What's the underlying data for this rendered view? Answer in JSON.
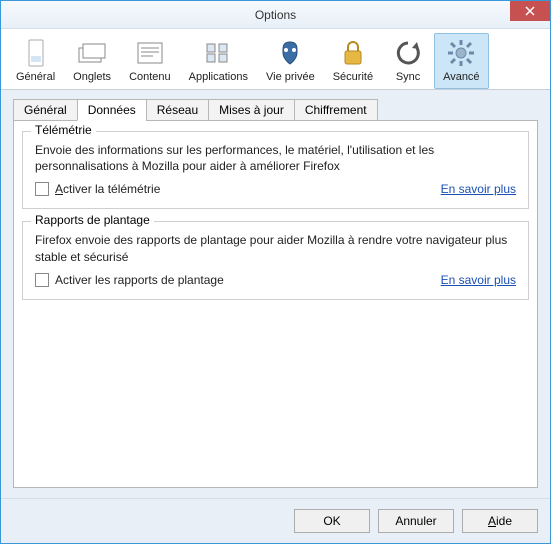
{
  "window": {
    "title": "Options"
  },
  "toolbar": [
    {
      "id": "general",
      "label": "Général"
    },
    {
      "id": "tabs",
      "label": "Onglets"
    },
    {
      "id": "content",
      "label": "Contenu"
    },
    {
      "id": "apps",
      "label": "Applications"
    },
    {
      "id": "privacy",
      "label": "Vie privée"
    },
    {
      "id": "security",
      "label": "Sécurité"
    },
    {
      "id": "sync",
      "label": "Sync"
    },
    {
      "id": "advanced",
      "label": "Avancé",
      "selected": true
    }
  ],
  "subtabs": [
    {
      "id": "gen",
      "label": "Général"
    },
    {
      "id": "data",
      "label": "Données",
      "active": true
    },
    {
      "id": "net",
      "label": "Réseau"
    },
    {
      "id": "upd",
      "label": "Mises à jour"
    },
    {
      "id": "enc",
      "label": "Chiffrement"
    }
  ],
  "groups": {
    "telemetry": {
      "title": "Télémétrie",
      "desc": "Envoie des informations sur les performances, le matériel, l'utilisation et les personnalisations à Mozilla pour aider à améliorer Firefox",
      "checkbox_pre": "A",
      "checkbox_post": "ctiver la télémétrie",
      "learn": "En savoir plus"
    },
    "crash": {
      "title": "Rapports de plantage",
      "desc": "Firefox envoie des rapports de plantage pour aider Mozilla à rendre votre navigateur plus stable et sécurisé",
      "checkbox_label": "Activer les rapports de plantage",
      "learn": "En savoir plus"
    }
  },
  "buttons": {
    "ok": "OK",
    "cancel": "Annuler",
    "help_pre": "A",
    "help_post": "ide"
  }
}
